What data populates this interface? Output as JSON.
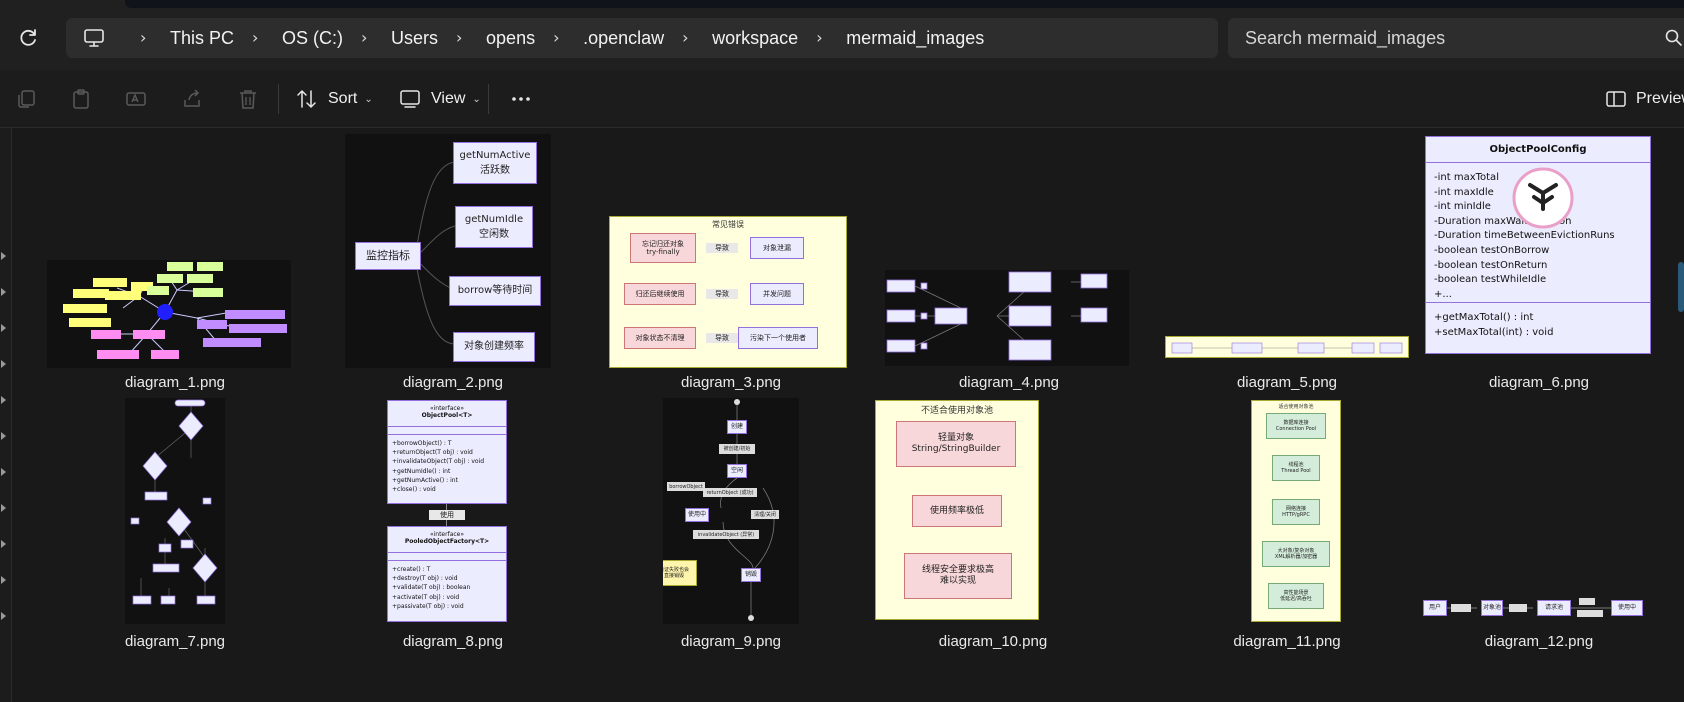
{
  "address_bar": {
    "breadcrumbs": [
      "This PC",
      "OS (C:)",
      "Users",
      "opens",
      ".openclaw",
      "workspace",
      "mermaid_images"
    ],
    "search_placeholder": "Search mermaid_images"
  },
  "toolbar": {
    "sort_label": "Sort",
    "view_label": "View",
    "preview_label": "Preview"
  },
  "icons": {
    "refresh": "refresh-icon",
    "computer": "computer-icon",
    "copy": "copy-icon",
    "paste": "paste-icon",
    "rename": "rename-icon",
    "share": "share-icon",
    "delete": "delete-icon",
    "sort": "sort-icon",
    "view": "view-icon",
    "more": "more-icon",
    "search": "search-icon",
    "preview": "preview-pane-icon"
  },
  "files": [
    {
      "name": "diagram_1.png"
    },
    {
      "name": "diagram_2.png"
    },
    {
      "name": "diagram_3.png"
    },
    {
      "name": "diagram_4.png"
    },
    {
      "name": "diagram_5.png"
    },
    {
      "name": "diagram_6.png"
    },
    {
      "name": "diagram_7.png"
    },
    {
      "name": "diagram_8.png"
    },
    {
      "name": "diagram_9.png"
    },
    {
      "name": "diagram_10.png"
    },
    {
      "name": "diagram_11.png"
    },
    {
      "name": "diagram_12.png"
    }
  ],
  "thumb2": {
    "root": "监控指标",
    "n1a": "getNumActive",
    "n1b": "活跃数",
    "n2a": "getNumIdle",
    "n2b": "空闲数",
    "n3": "borrow等待时间",
    "n4": "对象创建频率"
  },
  "thumb3": {
    "title": "常见错误",
    "r1a": "忘记归还对象\ntry-finally",
    "r1b": "导致",
    "r1c": "对象泄漏",
    "r2a": "归还后继续使用",
    "r2b": "导致",
    "r2c": "并发问题",
    "r3a": "对象状态不清理",
    "r3b": "导致",
    "r3c": "污染下一个使用者"
  },
  "thumb6": {
    "title": "ObjectPoolConfig",
    "fields": [
      "-int maxTotal",
      "-int maxIdle",
      "-int minIdle",
      "-Duration maxWaitDuration",
      "-Duration timeBetweenEvictionRuns",
      "-boolean testOnBorrow",
      "-boolean testOnReturn",
      "-boolean testWhileIdle",
      "+..."
    ],
    "methods": [
      "+getMaxTotal() : int",
      "+setMaxTotal(int) : void"
    ]
  },
  "thumb8": {
    "iface1_stereo": "«interface»",
    "iface1_name": "ObjectPool<T>",
    "iface1_methods": [
      "+borrowObject() : T",
      "+returnObject(T obj) : void",
      "+invalidateObject(T obj) : void",
      "+getNumIdle() : int",
      "+getNumActive() : int",
      "+close() : void"
    ],
    "link": "使用",
    "iface2_stereo": "«interface»",
    "iface2_name": "PooledObjectFactory<T>",
    "iface2_methods": [
      "+create() : T",
      "+destroy(T obj) : void",
      "+validate(T obj) : boolean",
      "+activate(T obj) : void",
      "+passivate(T obj) : void"
    ]
  },
  "thumb9": {
    "s1": "创建",
    "e1": "被创建/初始",
    "s2": "空闲",
    "e2": "borrowObject",
    "e3": "returnObject (成功)",
    "s3": "使用中",
    "e4": "清理/关闭",
    "e5": "invalidateObject (异常)",
    "s4": "销毁",
    "note": "验证失败也会\n直接销毁"
  },
  "thumb10": {
    "title": "不适合使用对象池",
    "b1": "轻量对象\nString/StringBuilder",
    "b2": "使用频率极低",
    "b3": "线程安全要求极高\n难以实现"
  },
  "thumb11": {
    "title": "适合使用对象池",
    "items": [
      "数据库连接\nConnection Pool",
      "线程池\nThread Pool",
      "网络连接\nHTTP/gRPC",
      "大对象/复杂对象\nXML解析器/加密器",
      "高性能场景\n低延迟/高吞吐"
    ]
  },
  "thumb12": {
    "n1": "用户",
    "n2": "对象池",
    "n3": "请求池",
    "n4": "使用中"
  }
}
